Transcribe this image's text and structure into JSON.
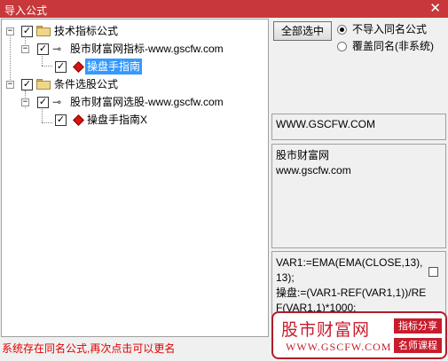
{
  "window": {
    "title": "导入公式",
    "close": "✕"
  },
  "tree": {
    "nodes": [
      {
        "expander": "−",
        "label": "技术指标公式"
      },
      {
        "expander": "−",
        "label": "股市财富网指标-www.gscfw.com"
      },
      {
        "label": "操盘手指南",
        "selected": true
      },
      {
        "expander": "−",
        "label": "条件选股公式"
      },
      {
        "expander": "−",
        "label": "股市财富网选股-www.gscfw.com"
      },
      {
        "label": "操盘手指南X"
      }
    ],
    "check_mark": "✓"
  },
  "controls": {
    "select_all": "全部选中",
    "radio_options": [
      {
        "label": "不导入同名公式",
        "checked": true
      },
      {
        "label": "覆盖同名(非系统)",
        "checked": false
      }
    ]
  },
  "info": {
    "url": "WWW.GSCFW.COM",
    "desc_line1": "股市财富网",
    "desc_line2": "www.gscfw.com",
    "code": "VAR1:=EMA(EMA(CLOSE,13),13);\n操盘:=(VAR1-REF(VAR1,1))/REF(VAR1,1)*1000;"
  },
  "status": "系统存在同名公式,再次点击可以更名",
  "watermark": {
    "name": "股市财富网",
    "url": "WWW.GSCFW.COM",
    "tag1": "指标分享",
    "tag2": "名师课程"
  },
  "colors": {
    "titlebar": "#c8383a",
    "selection": "#3399ff",
    "status": "#e00000",
    "brand": "#c81c2c"
  }
}
